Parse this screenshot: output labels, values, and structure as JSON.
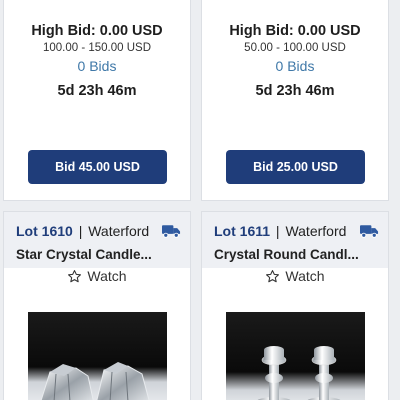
{
  "cards_top": [
    {
      "high_bid": "High Bid: 0.00 USD",
      "range": "100.00 - 150.00 USD",
      "bids": "0 Bids",
      "time_left": "5d 23h 46m",
      "bid_button": "Bid 45.00 USD"
    },
    {
      "high_bid": "High Bid: 0.00 USD",
      "range": "50.00 - 100.00 USD",
      "bids": "0 Bids",
      "time_left": "5d 23h 46m",
      "bid_button": "Bid 25.00 USD"
    }
  ],
  "cards_bottom": [
    {
      "lot": "Lot 1610",
      "brand": "Waterford",
      "title": "Star Crystal Candle...",
      "watch_label": "Watch",
      "icons": {
        "shipping": "truck-icon",
        "watch": "star-outline-icon"
      }
    },
    {
      "lot": "Lot 1611",
      "brand": "Waterford",
      "title": "Crystal Round Candl...",
      "watch_label": "Watch",
      "icons": {
        "shipping": "truck-icon",
        "watch": "star-outline-icon"
      }
    }
  ],
  "colors": {
    "primary_button": "#1f3d7a",
    "lot_number": "#1f3d7a",
    "bids_link": "#3f78a8",
    "truck": "#2f5aa0"
  }
}
